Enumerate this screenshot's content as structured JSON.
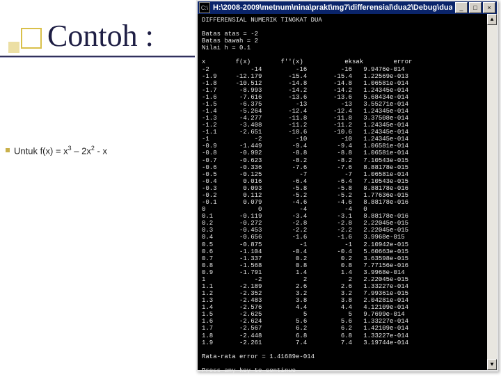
{
  "slide": {
    "title": "Contoh :",
    "formula_prefix": "Untuk f(x) = x",
    "formula_mid": " – 2x",
    "formula_suffix": " - x",
    "sup3": "3",
    "sup2": "2"
  },
  "window": {
    "title": "H:\\2008-2009\\metnum\\nina\\prakt\\mg7\\differensial\\dua2\\Debug\\dua...",
    "icon_label": "C:\\",
    "min": "_",
    "max": "□",
    "close": "×",
    "scroll_up": "▲",
    "scroll_down": "▼"
  },
  "console": {
    "header_line": "DIFFERENSIAL NUMERIK TINGKAT DUA",
    "meta": [
      "Batas atas = -2",
      "Batas bawah = 2",
      "Nilai h = 0.1"
    ],
    "col_headers": "x        f(x)        f''(x)           eksak        error",
    "rows": [
      [
        "-2",
        "-14",
        "-16",
        "-16",
        "9.9476e-014"
      ],
      [
        "-1.9",
        "-12.179",
        "-15.4",
        "-15.4",
        "1.22569e-013"
      ],
      [
        "-1.8",
        "-10.512",
        "-14.8",
        "-14.8",
        "1.06581e-014"
      ],
      [
        "-1.7",
        "-8.993",
        "-14.2",
        "-14.2",
        "1.24345e-014"
      ],
      [
        "-1.6",
        "-7.616",
        "-13.6",
        "-13.6",
        "5.68434e-014"
      ],
      [
        "-1.5",
        "-6.375",
        "-13",
        "-13",
        "3.55271e-014"
      ],
      [
        "-1.4",
        "-5.264",
        "-12.4",
        "-12.4",
        "1.24345e-014"
      ],
      [
        "-1.3",
        "-4.277",
        "-11.8",
        "-11.8",
        "3.37508e-014"
      ],
      [
        "-1.2",
        "-3.408",
        "-11.2",
        "-11.2",
        "1.24345e-014"
      ],
      [
        "-1.1",
        "-2.651",
        "-10.6",
        "-10.6",
        "1.24345e-014"
      ],
      [
        "-1",
        "-2",
        "-10",
        "-10",
        "1.24345e-014"
      ],
      [
        "-0.9",
        "-1.449",
        "-9.4",
        "-9.4",
        "1.06581e-014"
      ],
      [
        "-0.8",
        "-0.992",
        "-8.8",
        "-8.8",
        "1.06581e-014"
      ],
      [
        "-0.7",
        "-0.623",
        "-8.2",
        "-8.2",
        "7.10543e-015"
      ],
      [
        "-0.6",
        "-0.336",
        "-7.6",
        "-7.6",
        "8.88178e-015"
      ],
      [
        "-0.5",
        "-0.125",
        "-7",
        "-7",
        "1.06581e-014"
      ],
      [
        "-0.4",
        "0.016",
        "-6.4",
        "-6.4",
        "7.10543e-015"
      ],
      [
        "-0.3",
        "0.093",
        "-5.8",
        "-5.8",
        "8.88178e-016"
      ],
      [
        "-0.2",
        "0.112",
        "-5.2",
        "-5.2",
        "1.77636e-015"
      ],
      [
        "-0.1",
        "0.079",
        "-4.6",
        "-4.6",
        "8.88178e-016"
      ],
      [
        "0",
        "0",
        "-4",
        "-4",
        "0"
      ],
      [
        "0.1",
        "-0.119",
        "-3.4",
        "-3.1",
        "8.88178e-016"
      ],
      [
        "0.2",
        "-0.272",
        "-2.8",
        "-2.8",
        "2.22045e-015"
      ],
      [
        "0.3",
        "-0.453",
        "-2.2",
        "-2.2",
        "2.22045e-015"
      ],
      [
        "0.4",
        "-0.656",
        "-1.6",
        "-1.6",
        "3.9968e-015"
      ],
      [
        "0.5",
        "-0.875",
        "-1",
        "-1",
        "2.10942e-015"
      ],
      [
        "0.6",
        "-1.104",
        "-0.4",
        "-0.4",
        "5.60663e-015"
      ],
      [
        "0.7",
        "-1.337",
        "0.2",
        "0.2",
        "3.63598e-015"
      ],
      [
        "0.8",
        "-1.568",
        "0.8",
        "0.8",
        "7.77156e-016"
      ],
      [
        "0.9",
        "-1.791",
        "1.4",
        "1.4",
        "3.9968e-014"
      ],
      [
        "1",
        "-2",
        "2",
        "2",
        "2.22045e-015"
      ],
      [
        "1.1",
        "-2.189",
        "2.6",
        "2.6",
        "1.33227e-014"
      ],
      [
        "1.2",
        "-2.352",
        "3.2",
        "3.2",
        "7.99361e-015"
      ],
      [
        "1.3",
        "-2.483",
        "3.8",
        "3.8",
        "2.04281e-014"
      ],
      [
        "1.4",
        "-2.576",
        "4.4",
        "4.4",
        "4.12109e-014"
      ],
      [
        "1.5",
        "-2.625",
        "5",
        "5",
        "9.7699e-014"
      ],
      [
        "1.6",
        "-2.624",
        "5.6",
        "5.6",
        "1.33227e-014"
      ],
      [
        "1.7",
        "-2.567",
        "6.2",
        "6.2",
        "1.42109e-014"
      ],
      [
        "1.8",
        "-2.448",
        "6.8",
        "6.8",
        "1.33227e-014"
      ],
      [
        "1.9",
        "-2.261",
        "7.4",
        "7.4",
        "3.19744e-014"
      ]
    ],
    "footer": "Rata-rata error = 1.41689e-014",
    "prompt": "Press any key to continue"
  }
}
